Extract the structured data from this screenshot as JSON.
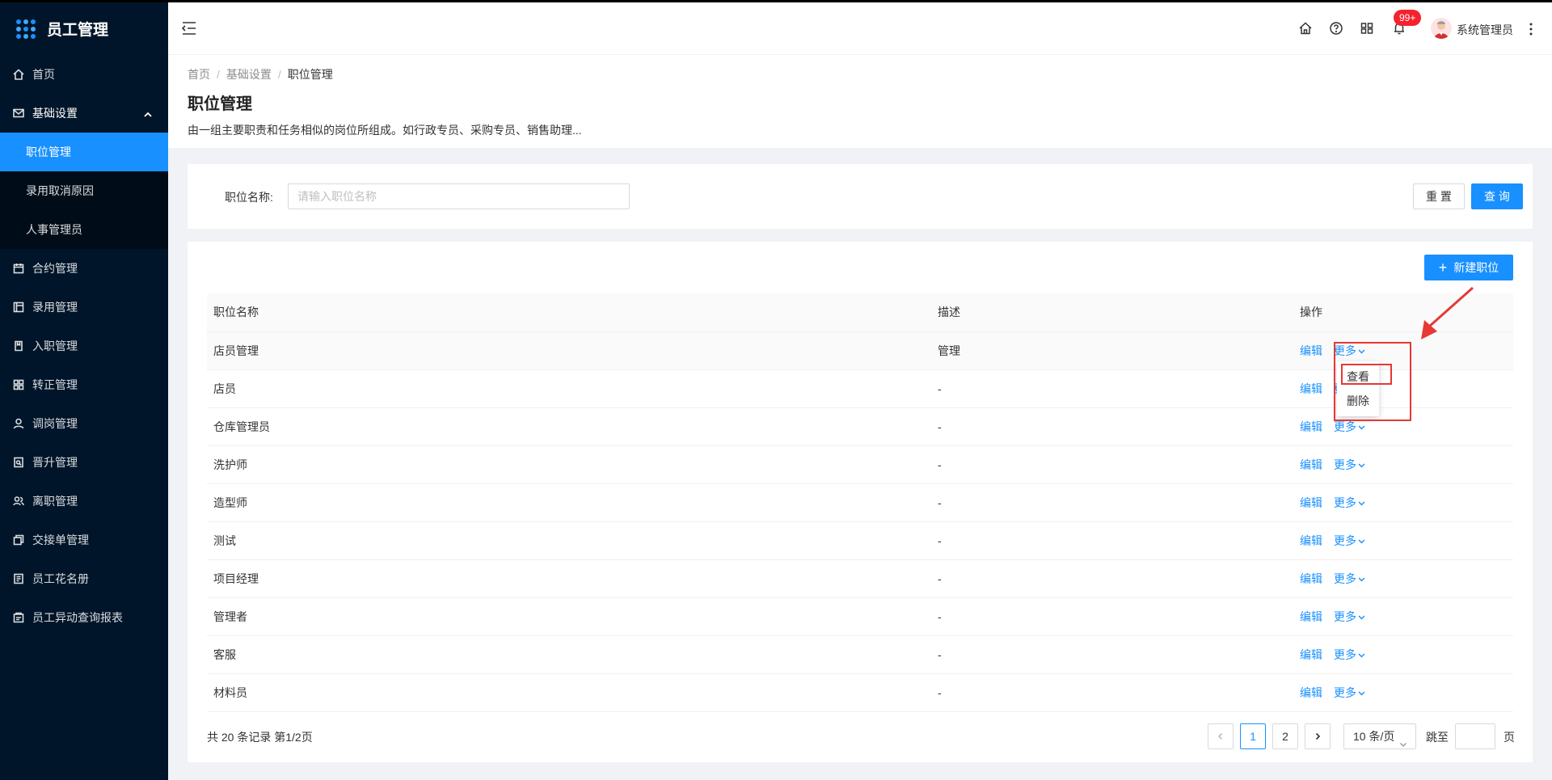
{
  "app": {
    "title": "员工管理"
  },
  "sidebar": {
    "items": [
      {
        "label": "首页",
        "icon": "home-icon"
      },
      {
        "label": "基础设置",
        "icon": "mail-icon",
        "expanded": true,
        "children": [
          {
            "label": "职位管理",
            "active": true
          },
          {
            "label": "录用取消原因"
          },
          {
            "label": "人事管理员"
          }
        ]
      },
      {
        "label": "合约管理",
        "icon": "calendar-icon"
      },
      {
        "label": "录用管理",
        "icon": "board-icon"
      },
      {
        "label": "入职管理",
        "icon": "book-icon"
      },
      {
        "label": "转正管理",
        "icon": "apps-icon"
      },
      {
        "label": "调岗管理",
        "icon": "user-icon"
      },
      {
        "label": "晋升管理",
        "icon": "doc-icon"
      },
      {
        "label": "离职管理",
        "icon": "people-icon"
      },
      {
        "label": "交接单管理",
        "icon": "copy-icon"
      },
      {
        "label": "员工花名册",
        "icon": "roster-icon"
      },
      {
        "label": "员工异动查询报表",
        "icon": "report-icon"
      }
    ]
  },
  "header": {
    "notification_badge": "99+",
    "user_name": "系统管理员"
  },
  "breadcrumb": {
    "home": "首页",
    "parent": "基础设置",
    "current": "职位管理"
  },
  "page": {
    "title": "职位管理",
    "description": "由一组主要职责和任务相似的岗位所组成。如行政专员、采购专员、销售助理..."
  },
  "search": {
    "label": "职位名称:",
    "placeholder": "请输入职位名称",
    "value": "",
    "reset_label": "重 置",
    "query_label": "查 询"
  },
  "table": {
    "new_button_label": "新建职位",
    "columns": [
      "职位名称",
      "描述",
      "操作"
    ],
    "edit_label": "编辑",
    "more_label": "更多",
    "rows": [
      {
        "name": "店员管理",
        "desc": "管理"
      },
      {
        "name": "店员",
        "desc": "-"
      },
      {
        "name": "仓库管理员",
        "desc": "-"
      },
      {
        "name": "洗护师",
        "desc": "-"
      },
      {
        "name": "造型师",
        "desc": "-"
      },
      {
        "name": "测试",
        "desc": "-"
      },
      {
        "name": "项目经理",
        "desc": "-"
      },
      {
        "name": "管理者",
        "desc": "-"
      },
      {
        "name": "客服",
        "desc": "-"
      },
      {
        "name": "材料员",
        "desc": "-"
      }
    ]
  },
  "dropdown": {
    "view_label": "查看",
    "delete_label": "删除"
  },
  "pagination": {
    "total_text": "共 20 条记录 第1/2页",
    "pages": [
      "1",
      "2"
    ],
    "current_page": "1",
    "page_size": "10 条/页",
    "jump_label": "跳至",
    "page_suffix": "页"
  },
  "colors": {
    "primary": "#1890ff",
    "sidebar_bg": "#001529",
    "highlight_red": "#e53935"
  }
}
